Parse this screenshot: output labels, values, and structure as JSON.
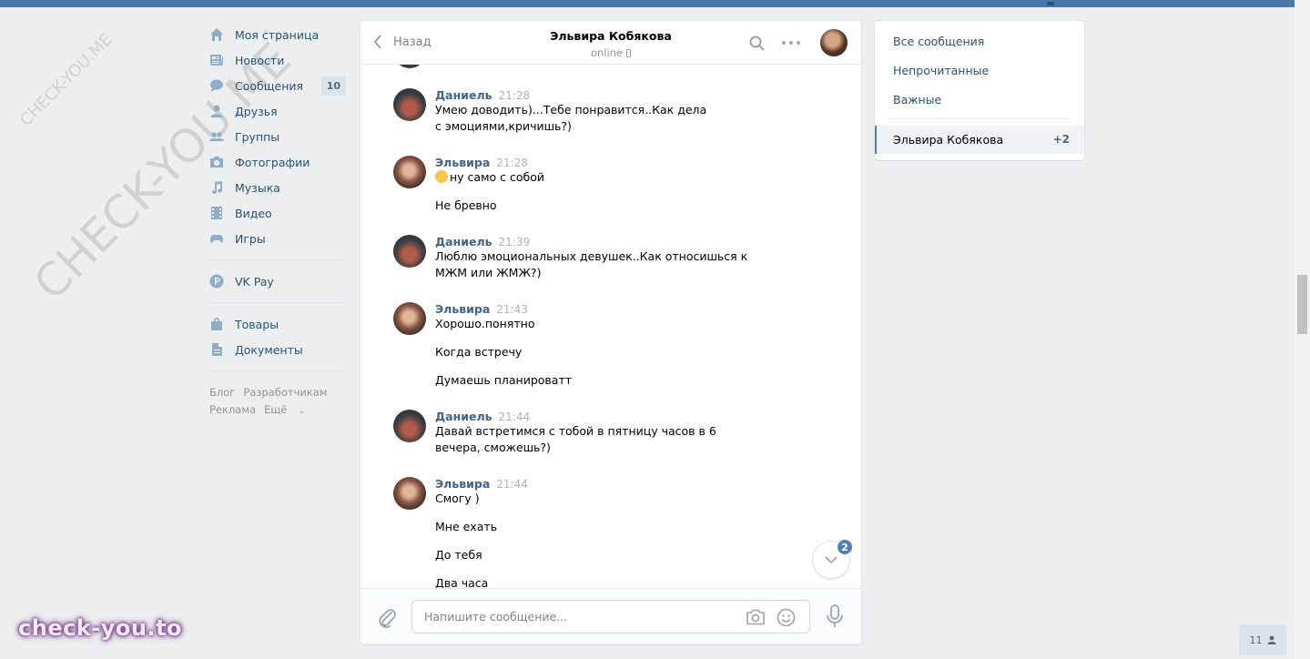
{
  "nav": {
    "items": [
      {
        "label": "Моя страница",
        "icon": "home-icon"
      },
      {
        "label": "Новости",
        "icon": "news-icon"
      },
      {
        "label": "Сообщения",
        "icon": "messages-icon",
        "count": "10"
      },
      {
        "label": "Друзья",
        "icon": "friends-icon"
      },
      {
        "label": "Группы",
        "icon": "groups-icon"
      },
      {
        "label": "Фотографии",
        "icon": "photos-icon"
      },
      {
        "label": "Музыка",
        "icon": "music-icon"
      },
      {
        "label": "Видео",
        "icon": "video-icon"
      },
      {
        "label": "Игры",
        "icon": "games-icon"
      }
    ],
    "vkpay": {
      "label": "VK Pay",
      "icon": "vkpay-icon"
    },
    "extra": [
      {
        "label": "Товары",
        "icon": "market-icon"
      },
      {
        "label": "Документы",
        "icon": "documents-icon"
      }
    ],
    "footer": {
      "blog": "Блог",
      "devs": "Разработчикам",
      "ads": "Реклама",
      "more": "Ещё"
    }
  },
  "watermark": {
    "small": "CHECK-YOU.ME",
    "large": "CHECK-YOU.ME"
  },
  "chat": {
    "back_label": "Назад",
    "peer_name": "Эльвира Кобякова",
    "peer_status": "online",
    "messages": [
      {
        "author": "Даниель",
        "time": "21:28",
        "side": "d",
        "lines": [
          "Умею доводить)...Тебе понравится..Как дела с эмоциями,кричишь?)"
        ]
      },
      {
        "author": "Эльвира",
        "time": "21:28",
        "side": "e",
        "lines": [
          "ну само с собой",
          "Не бревно"
        ]
      },
      {
        "author": "Даниель",
        "time": "21:39",
        "side": "d",
        "lines": [
          "Люблю эмоциональных девушек..Как относишься к МЖМ или ЖМЖ?)"
        ]
      },
      {
        "author": "Эльвира",
        "time": "21:43",
        "side": "e",
        "lines": [
          "Хорошо.понятно",
          "Когда встречу",
          "Думаешь планироватт"
        ]
      },
      {
        "author": "Даниель",
        "time": "21:44",
        "side": "d",
        "lines": [
          "Давай встретимся с тобой в пятницу часов в 6 вечера, сможешь?)"
        ]
      },
      {
        "author": "Эльвира",
        "time": "21:44",
        "side": "e",
        "lines": [
          "Смогу )",
          "Мне ехать",
          "До тебя",
          "Два часа"
        ]
      }
    ],
    "unread_badge": "2",
    "input_placeholder": "Напишите сообщение..."
  },
  "right": {
    "all": "Все сообщения",
    "unread": "Непрочитанные",
    "important": "Важные",
    "active_name": "Эльвира Кобякова",
    "active_count": "+2"
  },
  "online_count": "11",
  "brand": "check-you.to",
  "colors": {
    "accent": "#4a76a8",
    "link": "#285473",
    "author": "#42648b"
  }
}
